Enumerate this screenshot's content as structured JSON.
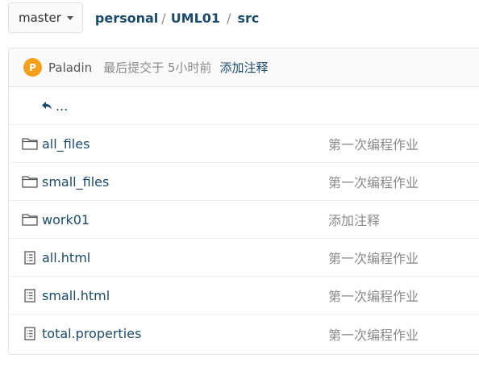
{
  "branch": {
    "label": "master"
  },
  "breadcrumb": {
    "owner": "personal",
    "repo": "UML01",
    "path": "src",
    "sep": "/"
  },
  "last_commit": {
    "avatar_letter": "P",
    "author": "Paladin",
    "meta": "最后提交于 5小时前",
    "message": "添加注释"
  },
  "parent_dir": {
    "label": "..."
  },
  "files": [
    {
      "name": "all_files",
      "type": "folder",
      "message": "第一次编程作业"
    },
    {
      "name": "small_files",
      "type": "folder",
      "message": "第一次编程作业"
    },
    {
      "name": "work01",
      "type": "folder",
      "message": "添加注释"
    },
    {
      "name": "all.html",
      "type": "file",
      "message": "第一次编程作业"
    },
    {
      "name": "small.html",
      "type": "file",
      "message": "第一次编程作业"
    },
    {
      "name": "total.properties",
      "type": "file",
      "message": "第一次编程作业"
    }
  ]
}
